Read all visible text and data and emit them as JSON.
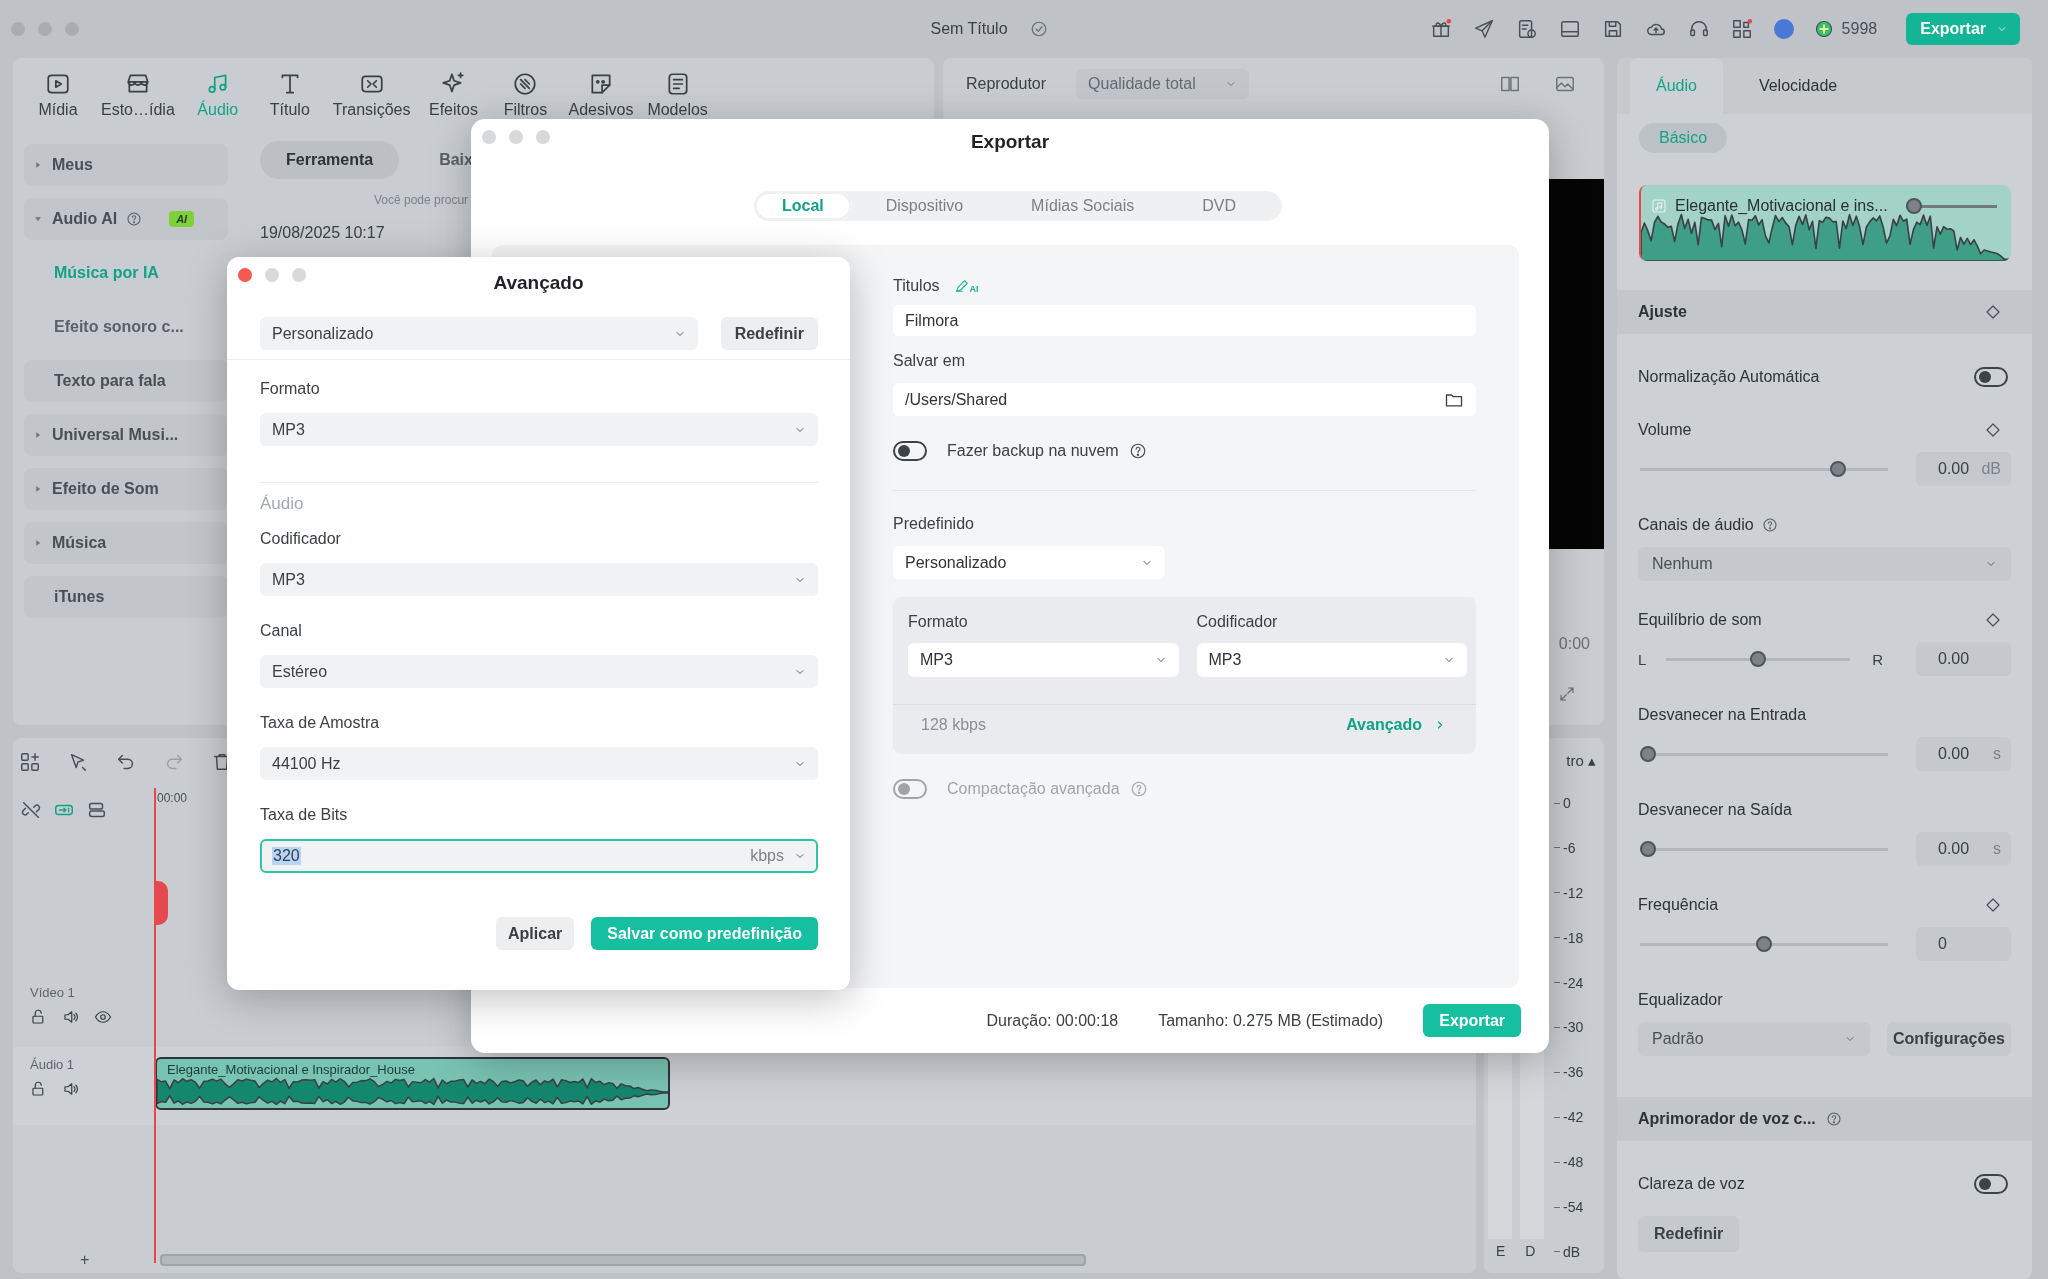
{
  "window": {
    "title": "Sem Título"
  },
  "top_bar": {
    "credits": "5998",
    "export_button": "Exportar"
  },
  "media_toolbar": [
    {
      "label": "Mídia",
      "selected": false
    },
    {
      "label": "Esto…ídia",
      "selected": false
    },
    {
      "label": "Áudio",
      "selected": true
    },
    {
      "label": "Título",
      "selected": false
    },
    {
      "label": "Transições",
      "selected": false
    },
    {
      "label": "Efeitos",
      "selected": false
    },
    {
      "label": "Filtros",
      "selected": false
    },
    {
      "label": "Adesivos",
      "selected": false
    },
    {
      "label": "Modelos",
      "selected": false
    }
  ],
  "library": {
    "tabs": [
      {
        "label": "Ferramenta",
        "selected": true
      },
      {
        "label": "Baix",
        "selected": false
      }
    ],
    "hint": "Você pode procur",
    "date": "19/08/2025 10:17"
  },
  "sidebar": {
    "items": [
      {
        "kind": "group",
        "label": "Meus",
        "expanded": false,
        "selected": false
      },
      {
        "kind": "group",
        "label": "Audio AI",
        "expanded": true,
        "selected": false,
        "help": true,
        "badge": "AI",
        "children": [
          {
            "label": "Música por IA",
            "selected": true
          },
          {
            "label": "Efeito sonoro c...",
            "selected": false
          }
        ]
      },
      {
        "kind": "leaf",
        "label": "Texto para fala",
        "selected": false
      },
      {
        "kind": "group",
        "label": "Universal Musi...",
        "expanded": false,
        "selected": false
      },
      {
        "kind": "group",
        "label": "Efeito de Som",
        "expanded": false,
        "selected": false
      },
      {
        "kind": "group",
        "label": "Música",
        "expanded": false,
        "selected": false
      },
      {
        "kind": "leaf",
        "label": "iTunes",
        "selected": false
      }
    ]
  },
  "player": {
    "title": "Reprodutor",
    "quality": "Qualidade total",
    "timecode": "0:00"
  },
  "timeline": {
    "ruler": "00:00",
    "tracks": [
      {
        "kind": "video",
        "name": "Vídeo 1"
      },
      {
        "kind": "audio",
        "name": "Áudio 1",
        "clip": "Elegante_Motivacional e Inspirador_House"
      }
    ],
    "add": "+"
  },
  "meter": {
    "label": "tro ▴",
    "scale": [
      "0",
      "-6",
      "-12",
      "-18",
      "-24",
      "-30",
      "-36",
      "-42",
      "-48",
      "-54",
      "dB"
    ],
    "channels": [
      "E",
      "D"
    ]
  },
  "inspector": {
    "tabs": [
      {
        "label": "Áudio",
        "selected": true
      },
      {
        "label": "Velocidade",
        "selected": false
      }
    ],
    "subtabs": [
      {
        "label": "Básico",
        "selected": true
      }
    ],
    "clip": {
      "name": "Elegante_Motivacional e ins...",
      "level": 0
    },
    "rows": [
      {
        "kind": "header",
        "label": "Ajuste",
        "keyframe": true
      },
      {
        "kind": "toggle",
        "label": "Normalização Automática",
        "on": false
      },
      {
        "kind": "slider",
        "label": "Volume",
        "keyframe": true,
        "level": 0.82,
        "value": "0.00",
        "unit": "dB"
      },
      {
        "kind": "select",
        "label": "Canais de áudio",
        "help": true,
        "value": "Nenhum"
      },
      {
        "kind": "balance",
        "label": "Equilíbrio de som",
        "keyframe": true,
        "left": "L",
        "right": "R",
        "level": 0.5,
        "value": "0.00"
      },
      {
        "kind": "slider",
        "label": "Desvanecer na Entrada",
        "level": 0,
        "value": "0.00",
        "unit": "s"
      },
      {
        "kind": "slider",
        "label": "Desvanecer na Saída",
        "level": 0,
        "value": "0.00",
        "unit": "s"
      },
      {
        "kind": "slider",
        "label": "Frequência",
        "keyframe": true,
        "level": 0.5,
        "value": "0"
      },
      {
        "kind": "equalizer",
        "label": "Equalizador",
        "value": "Padrão",
        "button": "Configurações"
      },
      {
        "kind": "header",
        "label": "Aprimorador de voz c...",
        "help": true
      },
      {
        "kind": "toggle",
        "label": "Clareza de voz",
        "on": false
      }
    ],
    "reset_button": "Redefinir"
  },
  "export_dialog": {
    "title": "Exportar",
    "tabs": [
      {
        "label": "Local",
        "selected": true
      },
      {
        "label": "Dispositivo",
        "selected": false
      },
      {
        "label": "Mídias Sociais",
        "selected": false
      },
      {
        "label": "DVD",
        "selected": false
      }
    ],
    "title_label": "Titulos",
    "ai_tag": "AI",
    "title_value": "Filmora",
    "save_label": "Salvar em",
    "save_path": "/Users/Shared",
    "backup": {
      "label": "Fazer backup na nuvem",
      "on": false
    },
    "preset_label": "Predefinido",
    "preset": "Personalizado",
    "format_label": "Formato",
    "format": "MP3",
    "codec_label": "Codificador",
    "codec": "MP3",
    "bitrate": "128 kbps",
    "advanced_link": "Avançado",
    "compression": {
      "label": "Compactação avançada",
      "on": false,
      "disabled": true
    },
    "duration": "Duração: 00:00:18",
    "size": "Tamanho: 0.275 MB (Estimado)",
    "export_button": "Exportar"
  },
  "advanced_dialog": {
    "title": "Avançado",
    "preset": "Personalizado",
    "reset_button": "Redefinir",
    "format_label": "Formato",
    "format": "MP3",
    "section": "Áudio",
    "fields": [
      {
        "label": "Codificador",
        "value": "MP3"
      },
      {
        "label": "Canal",
        "value": "Estéreo"
      },
      {
        "label": "Taxa de Amostra",
        "value": "44100 Hz"
      }
    ],
    "bitrate_label": "Taxa de Bits",
    "bitrate": "320",
    "bitrate_unit": "kbps",
    "apply_button": "Aplicar",
    "save_button": "Salvar como predefinição"
  }
}
